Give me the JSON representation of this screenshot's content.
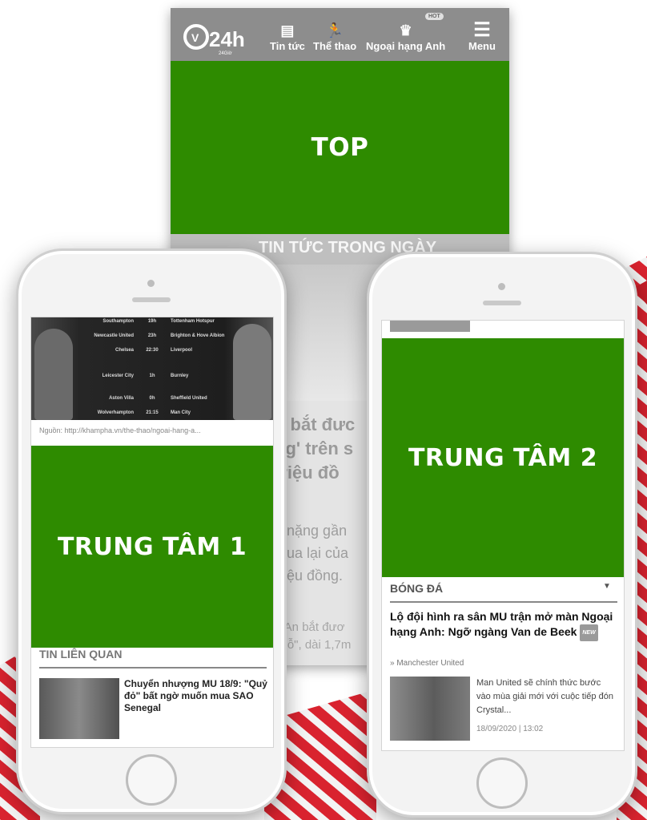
{
  "colors": {
    "ad_green": "#2e8b00",
    "nav_gray": "#8d8d8d",
    "stripe_red": "#d9232f"
  },
  "top_screen": {
    "nav": {
      "logo_text": "24h",
      "logo_subtext": "24Giờ",
      "items": [
        {
          "label": "Tin tức",
          "icon": "newspaper-icon"
        },
        {
          "label": "Thể thao",
          "icon": "running-icon"
        },
        {
          "label": "Ngoại hạng Anh",
          "icon": "premier-league-lion-icon"
        },
        {
          "label": "Menu",
          "icon": "hamburger-icon"
        }
      ],
      "hot_badge": "HOT"
    },
    "ad_label": "TOP",
    "section_title": "TIN TỨC TRONG NGÀY",
    "headline_fragment": "u bắt đưc\nng' trên s\ntriệu đồ",
    "body_fragment": "h nặng gần\nmua lại của\ntriệu đồng.",
    "bottom_fragment": "ệ An bắt đươ\ng lỗ\", dài 1,7m"
  },
  "left_phone": {
    "fixtures": [
      {
        "home": "Southampton",
        "score": "19h",
        "away": "Tottenham Hotspur"
      },
      {
        "home": "Newcastle United",
        "score": "23h",
        "away": "Brighton & Hove Albion"
      },
      {
        "home": "Chelsea",
        "score": "22:30",
        "away": "Liverpool"
      },
      {
        "home": "Leicester City",
        "score": "1h",
        "away": "Burnley"
      },
      {
        "home": "Aston Villa",
        "score": "0h",
        "away": "Sheffield United"
      },
      {
        "home": "Wolverhampton",
        "score": "21:15",
        "away": "Man City"
      }
    ],
    "source": "Nguồn: http://khampha.vn/the-thao/ngoai-hang-a...",
    "ad_label": "TRUNG TÂM 1",
    "related_header": "TIN LIÊN QUAN",
    "related_title": "Chuyển nhượng MU 18/9: \"Quỷ đỏ\" bất ngờ muốn mua SAO Senegal"
  },
  "right_phone": {
    "ad_label": "TRUNG TÂM 2",
    "category_header": "BÓNG ĐÁ",
    "article_title": "Lộ đội hình ra sân MU trận mở màn Ngoại hạng Anh: Ngỡ ngàng Van de Beek",
    "new_tag": "NEW",
    "tag": "» Manchester United",
    "description": "Man United sẽ chính thức bước vào mùa giải mới với cuộc tiếp đón Crystal...",
    "date": "18/09/2020 | 13:02"
  }
}
